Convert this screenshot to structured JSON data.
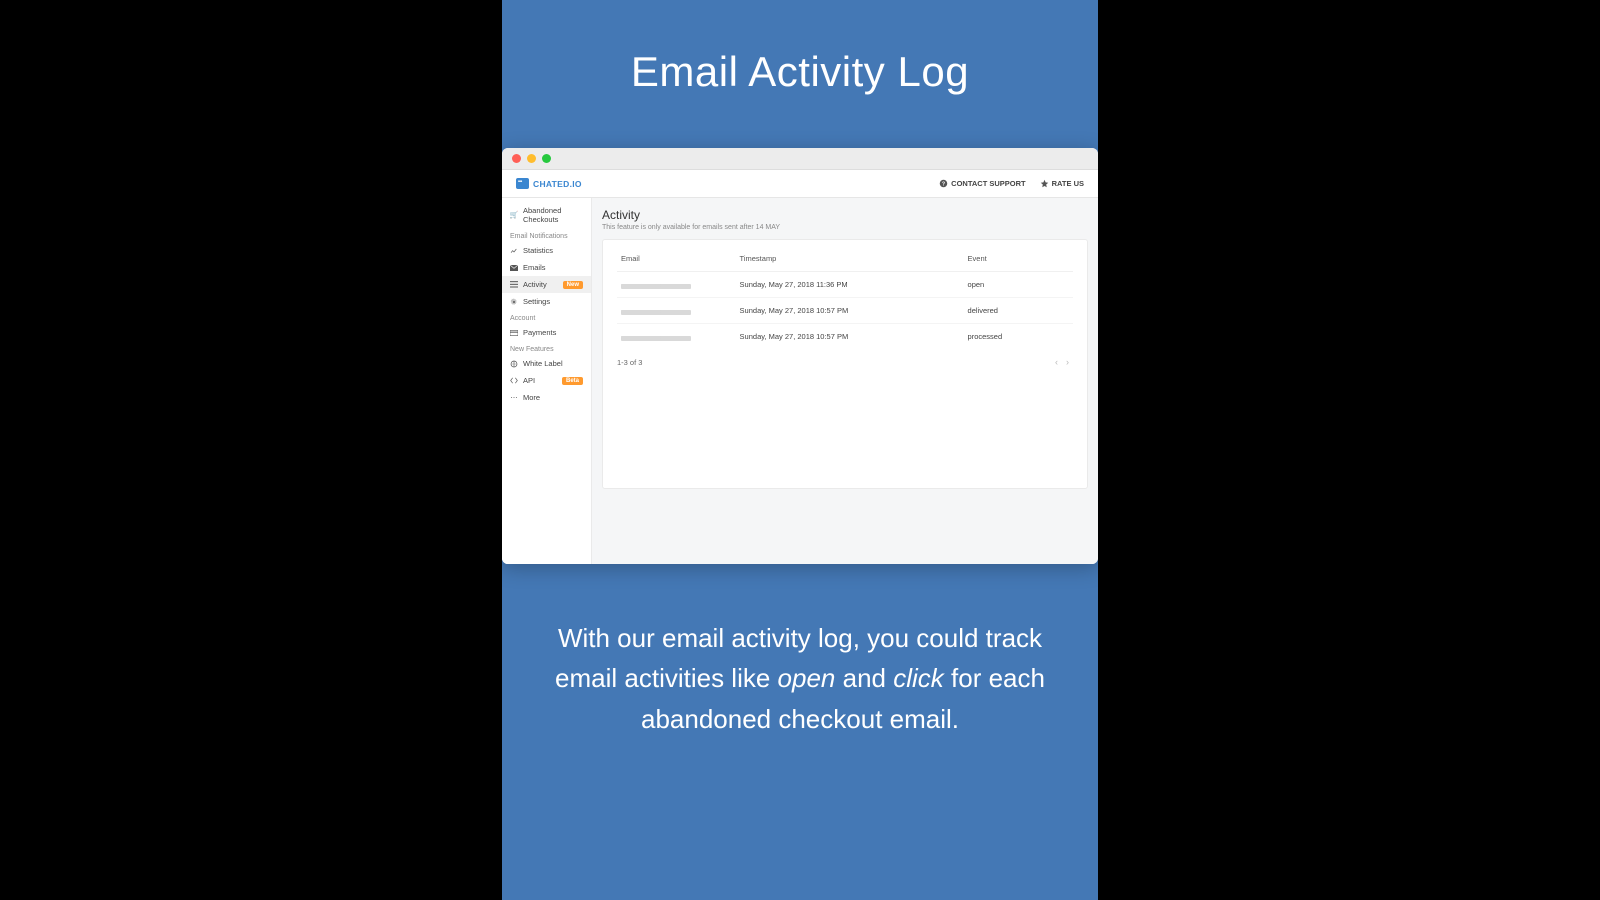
{
  "hero": {
    "title": "Email Activity Log",
    "subtitle_parts": [
      "With our email activity log, you could track email activities like ",
      "open",
      " and ",
      "click",
      " for each abandoned checkout email."
    ]
  },
  "brand": "CHATED.IO",
  "header_links": {
    "support": "CONTACT SUPPORT",
    "rate": "RATE US"
  },
  "sidebar": {
    "top_item": "Abandoned Checkouts",
    "sections": {
      "email": "Email Notifications",
      "account": "Account",
      "features": "New Features"
    },
    "items": {
      "statistics": "Statistics",
      "emails": "Emails",
      "activity": "Activity",
      "settings": "Settings",
      "payments": "Payments",
      "whitelabel": "White Label",
      "api": "API",
      "more": "More"
    },
    "badges": {
      "new": "New",
      "beta": "Beta"
    }
  },
  "main": {
    "title": "Activity",
    "note": "This feature is only available for emails sent after 14 MAY",
    "columns": {
      "email": "Email",
      "timestamp": "Timestamp",
      "event": "Event"
    },
    "rows": [
      {
        "timestamp": "Sunday, May 27, 2018 11:36 PM",
        "event": "open"
      },
      {
        "timestamp": "Sunday, May 27, 2018 10:57 PM",
        "event": "delivered"
      },
      {
        "timestamp": "Sunday, May 27, 2018 10:57 PM",
        "event": "processed"
      }
    ],
    "pager": "1-3 of 3"
  }
}
